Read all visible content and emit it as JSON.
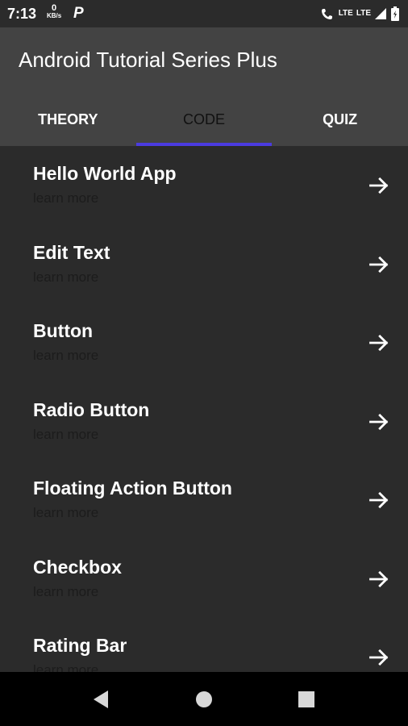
{
  "status_bar": {
    "time": "7:13",
    "kbps_value": "0",
    "kbps_unit": "KB/s",
    "p_icon": "P",
    "lte_label": "LTE",
    "volte_label": "LTE"
  },
  "app_bar": {
    "title": "Android Tutorial Series Plus"
  },
  "tabs": [
    {
      "label": "THEORY"
    },
    {
      "label": "CODE"
    },
    {
      "label": "QUIZ"
    }
  ],
  "items": [
    {
      "title": "Hello World App",
      "subtitle": "learn more"
    },
    {
      "title": "Edit Text",
      "subtitle": "learn more"
    },
    {
      "title": "Button",
      "subtitle": "learn more"
    },
    {
      "title": "Radio Button",
      "subtitle": "learn more"
    },
    {
      "title": "Floating Action Button",
      "subtitle": "learn more"
    },
    {
      "title": "Checkbox",
      "subtitle": "learn more"
    },
    {
      "title": "Rating Bar",
      "subtitle": "learn more"
    }
  ],
  "icons": {
    "arrow": "arrow-right-icon",
    "back": "back-triangle-icon",
    "home": "home-circle-icon",
    "recents": "recents-square-icon"
  },
  "colors": {
    "accent": "#4b3be0",
    "app_bar": "#434343",
    "background": "#2b2b2b"
  }
}
